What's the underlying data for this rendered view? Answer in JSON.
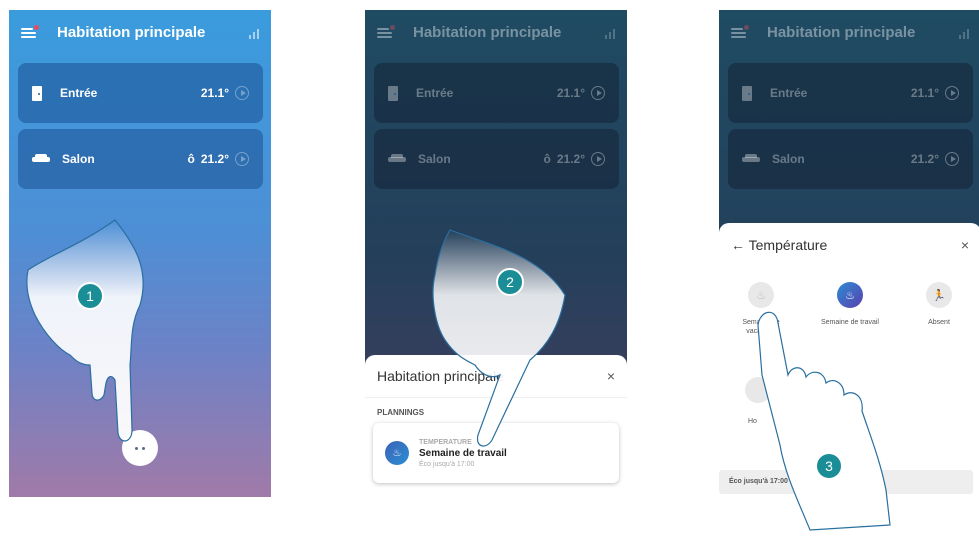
{
  "header": {
    "title": "Habitation principale"
  },
  "rooms": [
    {
      "name": "Entrée",
      "temp": "21.1°"
    },
    {
      "name": "Salon",
      "temp": "21.2°",
      "flame": "🔥"
    }
  ],
  "step_numbers": [
    "1",
    "2",
    "3"
  ],
  "sheet2": {
    "title": "Habitation principale",
    "section": "PLANNINGS",
    "card": {
      "category": "TEMPERATURE",
      "name": "Semaine de travail",
      "sub": "Éco jusqu'à 17:00"
    },
    "close": "×"
  },
  "sheet3": {
    "title": "← Température",
    "close": "×",
    "modes": [
      {
        "label": "Semaine de vacances",
        "icon": "♨"
      },
      {
        "label": "Semaine de travail",
        "icon": "♨"
      },
      {
        "label": "Absent",
        "icon": "🏃"
      }
    ],
    "extra_mode_label": "Ho",
    "eco": "Éco jusqu'à 17:00"
  },
  "colors": {
    "accent": "#1a8d96",
    "blue": "#3a9cdd"
  }
}
